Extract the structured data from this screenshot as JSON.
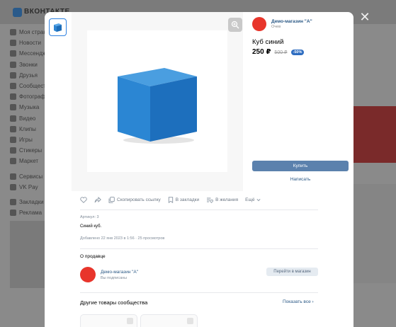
{
  "background": {
    "brand": "ВКОНТАКТЕ",
    "nav_items": [
      "Моя страница",
      "Новости",
      "Мессенджер",
      "Звонки",
      "Друзья",
      "Сообщества",
      "Фотографии",
      "Музыка",
      "Видео",
      "Клипы",
      "Игры",
      "Стикеры",
      "Маркет",
      "Сервисы",
      "VK Pay",
      "Закладки",
      "Реклама"
    ]
  },
  "modal": {
    "close_icon": "close-icon",
    "seller_head": {
      "name": "Демо-магазин \"А\"",
      "sub": "Очев"
    },
    "product": {
      "title": "Куб синий",
      "price": "250 ₽",
      "old_price": "500 ₽",
      "discount": "-50%"
    },
    "buy_label": "Купить",
    "write_label": "Написать",
    "actions": {
      "copy_link": "Скопировать ссылку",
      "bookmarks": "В закладки",
      "wishlist": "В желания",
      "more": "Ещё"
    },
    "article": "Артикул: 3",
    "description": "Синий куб.",
    "added": "Добавлено 22 янв 2023 в 1:56 · 25 просмотров",
    "about_seller_label": "О продавце",
    "seller_block": {
      "name": "Демо-магазин \"А\"",
      "sub": "Вы подписаны"
    },
    "store_button": "Перейти в магазин",
    "other_title": "Другие товары сообщества",
    "show_all": "Показать все"
  },
  "colors": {
    "accent": "#2a5885",
    "button": "#5b81ad",
    "avatar": "#e8352b",
    "discount": "#2d6cc0"
  }
}
